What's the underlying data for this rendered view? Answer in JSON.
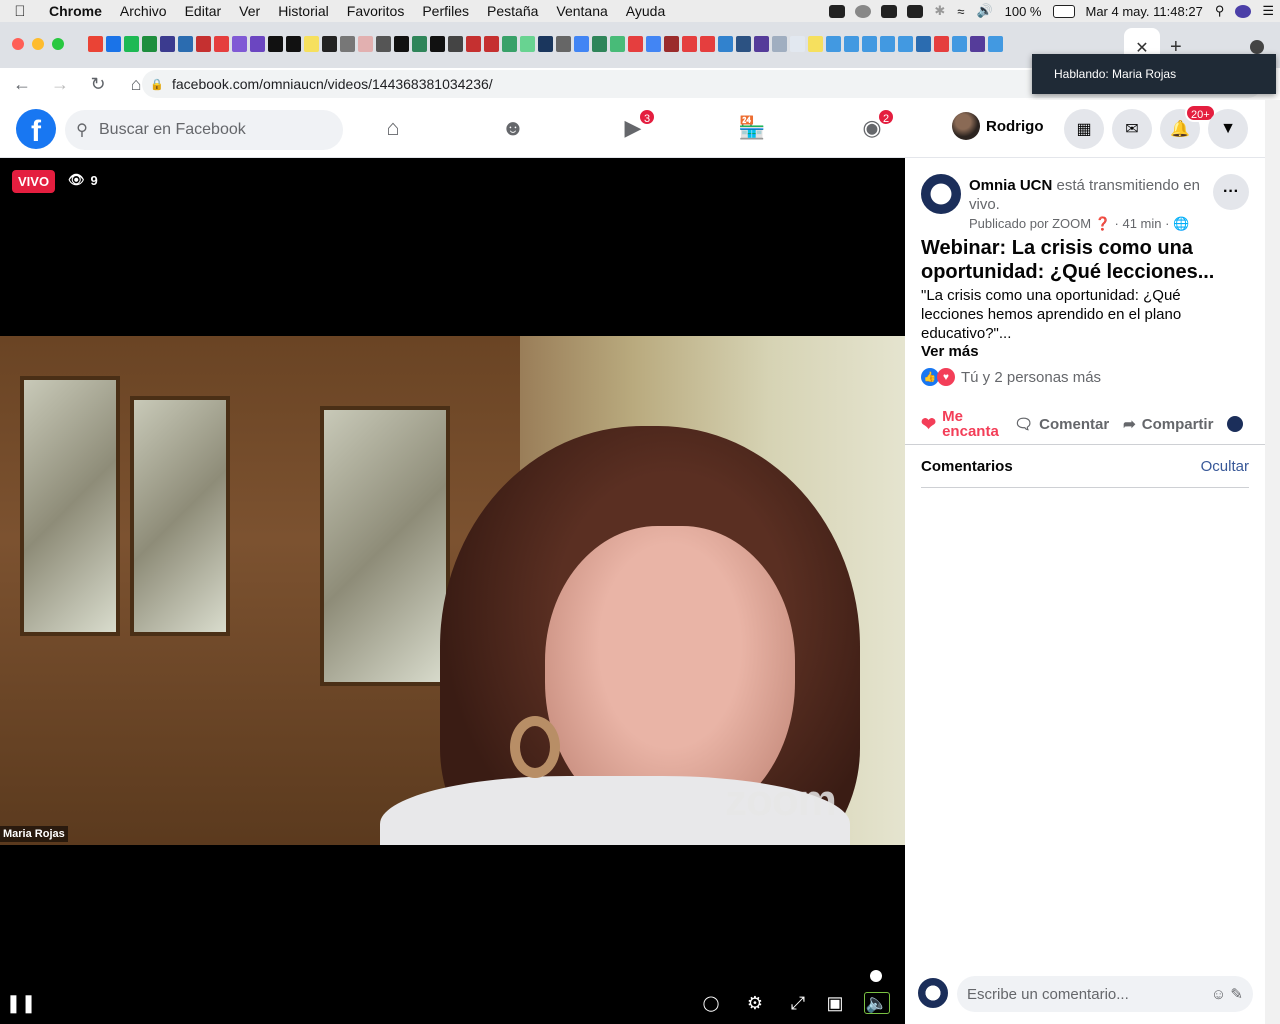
{
  "menubar": {
    "app": "Chrome",
    "items": [
      "Archivo",
      "Editar",
      "Ver",
      "Historial",
      "Favoritos",
      "Perfiles",
      "Pestaña",
      "Ventana",
      "Ayuda"
    ],
    "battery": "100 %",
    "datetime": "Mar 4 may.  11:48:27"
  },
  "browser": {
    "url": "facebook.com/omniaucn/videos/144368381034236/",
    "tooltip": "Hablando: Maria Rojas"
  },
  "fb": {
    "search_placeholder": "Buscar en Facebook",
    "watch_badge": "3",
    "groups_badge": "2",
    "profile_name": "Rodrigo",
    "notif_badge": "20+"
  },
  "video": {
    "live_label": "VIVO",
    "viewers": "9",
    "speaker_name": "Maria Rojas",
    "watermark": "zoom"
  },
  "post": {
    "page_name": "Omnia UCN",
    "status_text": "está transmitiendo en vivo.",
    "published_by": "Publicado por ZOOM",
    "time_ago": "41 min",
    "title": "Webinar: La crisis como una oportunidad: ¿Qué lecciones...",
    "description": "\"La crisis como una oportunidad: ¿Qué lecciones hemos aprendido en el plano educativo?\"...",
    "see_more": "Ver más",
    "reactions_text": "Tú y 2 personas más",
    "love_label": "Me encanta",
    "comment_label": "Comentar",
    "share_label": "Compartir",
    "comments_heading": "Comentarios",
    "hide_label": "Ocultar",
    "comment_placeholder": "Escribe un comentario..."
  }
}
